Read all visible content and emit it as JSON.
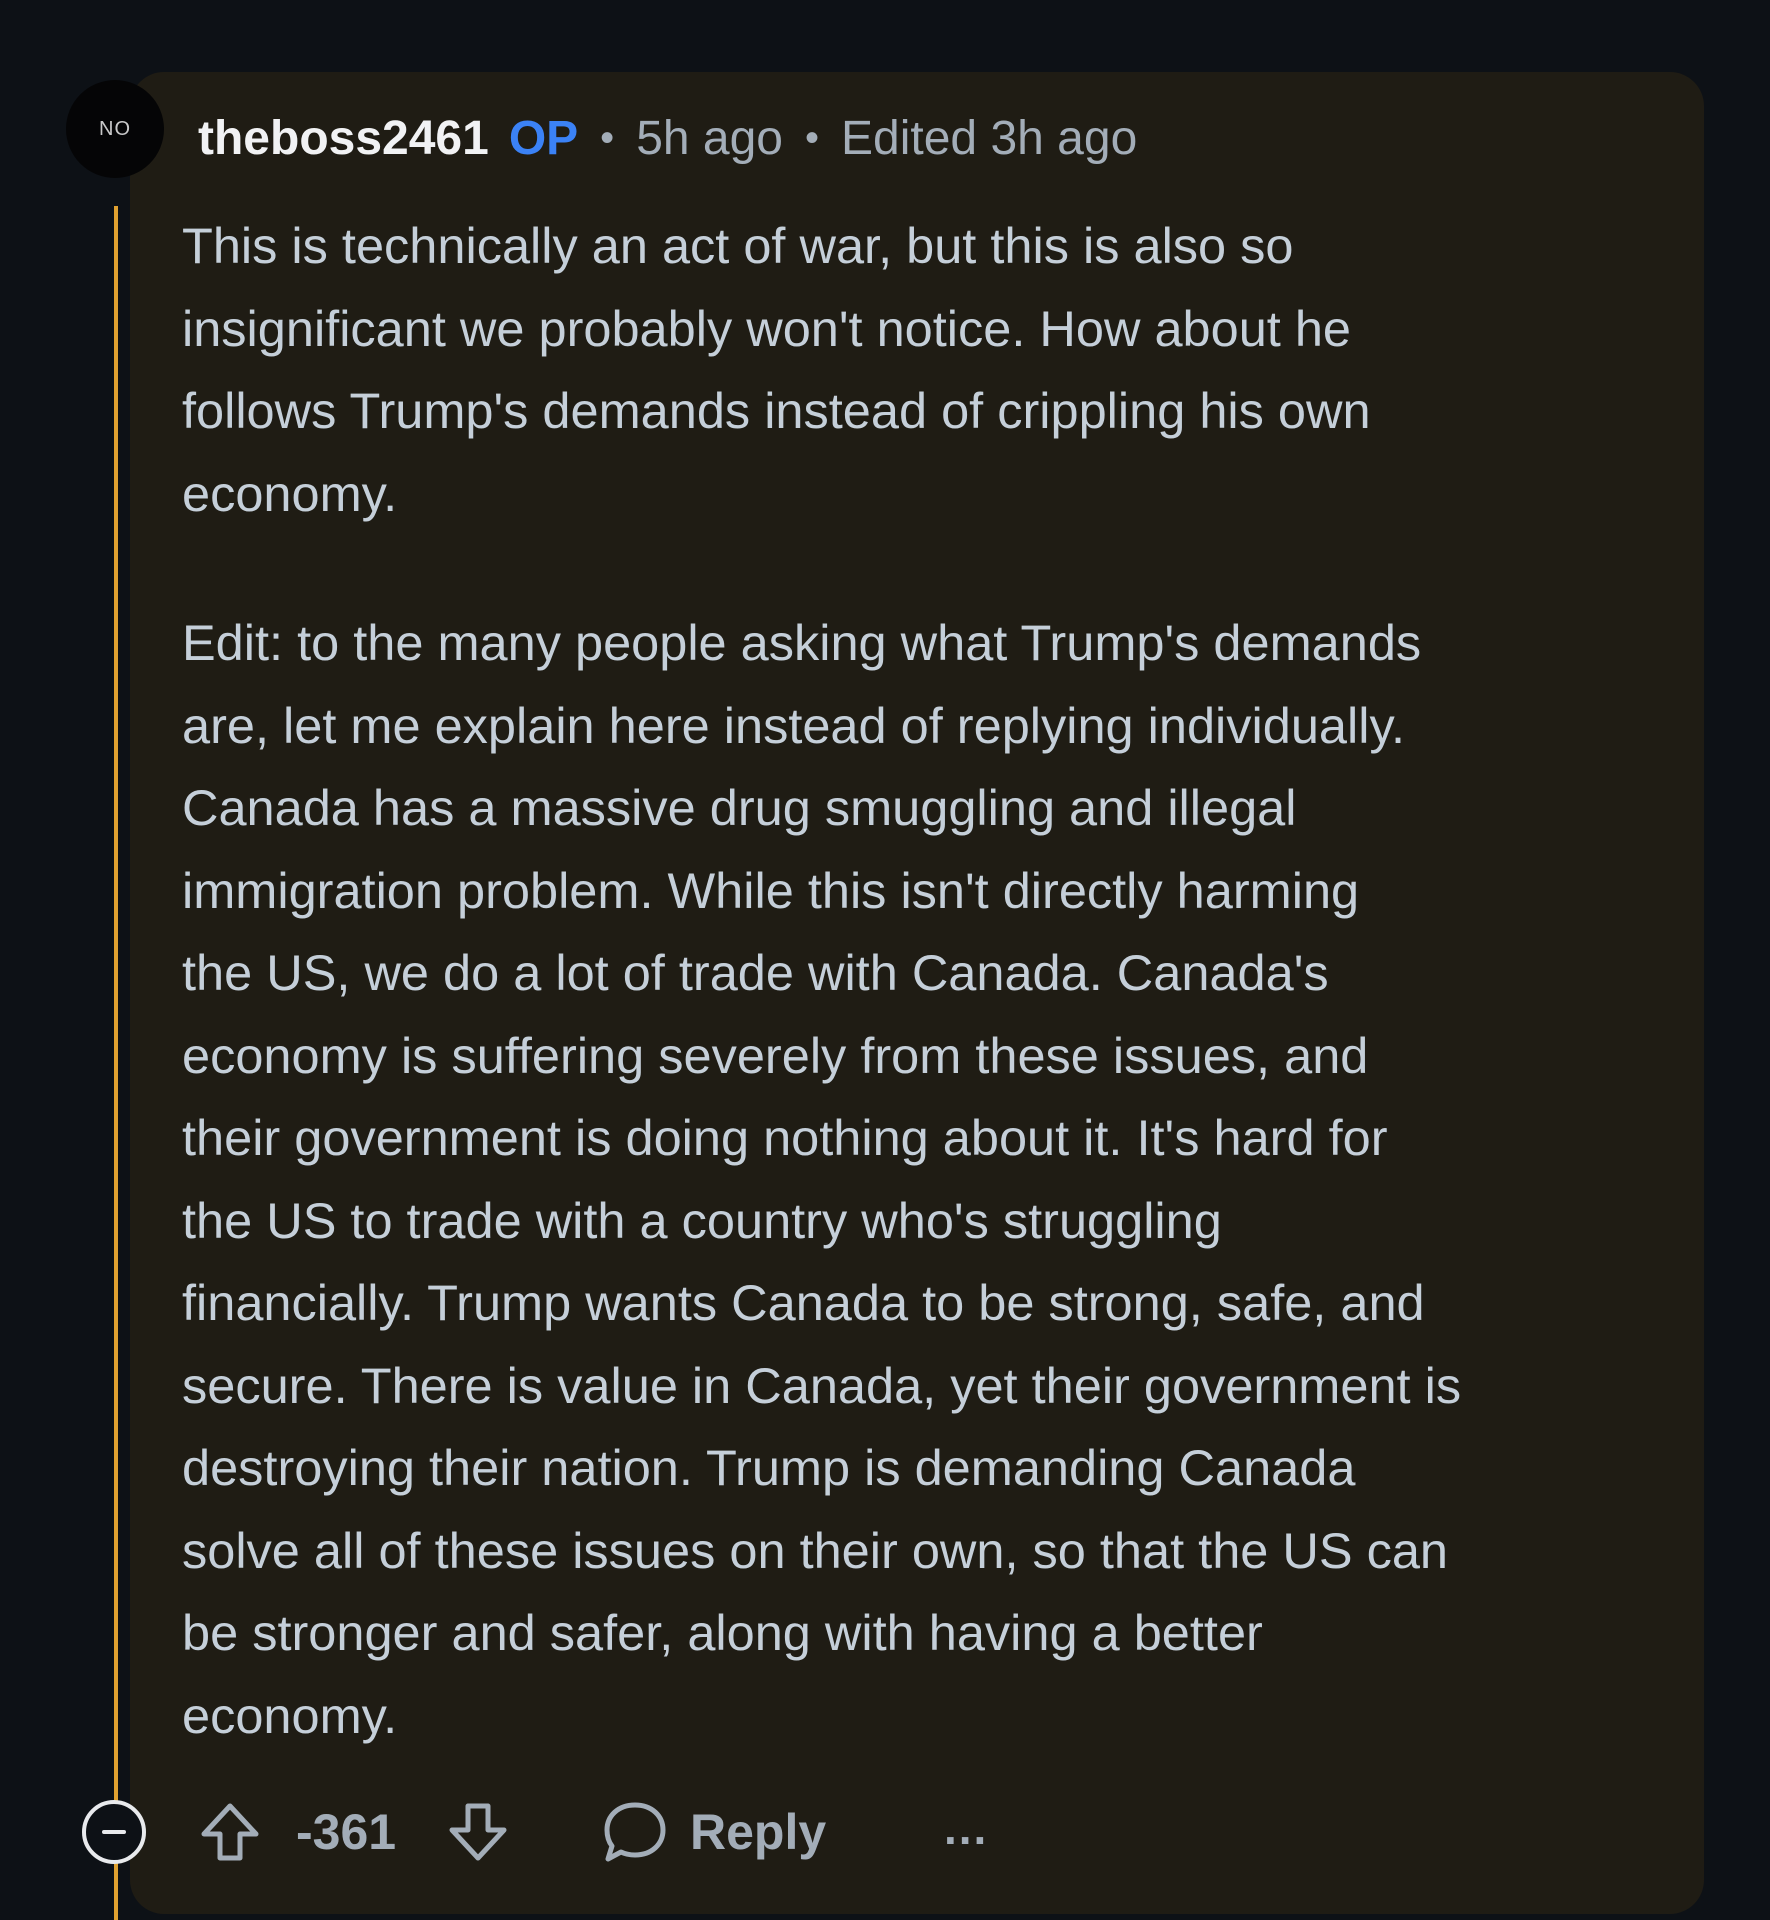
{
  "comment": {
    "avatar_text": "NO",
    "username": "theboss2461",
    "op_badge": "OP",
    "separator": "•",
    "time_posted": "5h ago",
    "edited": "Edited 3h ago",
    "paragraphs": [
      "This is technically an act of war, but this is also so\ninsignificant we probably won't notice. How about he\nfollows Trump's demands instead of crippling his own\neconomy.",
      "Edit: to the many people asking what Trump's demands\nare, let me explain here instead of replying individually.\nCanada has a massive drug smuggling and illegal\nimmigration problem. While this isn't directly harming\nthe US, we do a lot of trade with Canada. Canada's\neconomy is suffering severely from these issues, and\ntheir government is doing nothing about it. It's hard for\nthe US to trade with a country who's struggling\nfinancially. Trump wants Canada to be strong, safe, and\nsecure. There is value in Canada, yet their government is\ndestroying their nation. Trump is demanding Canada\nsolve all of these issues on their own, so that the US can\nbe stronger and safer, along with having a better\neconomy."
    ]
  },
  "actions": {
    "score": "-361",
    "reply_label": "Reply",
    "more_label": "..."
  },
  "icons": {
    "collapse": "minus-circle-icon",
    "upvote": "arrow-up-icon",
    "downvote": "arrow-down-icon",
    "reply": "speech-bubble-icon"
  },
  "colors": {
    "background": "#0d1116",
    "card": "#1f1c14",
    "thread_line": "#e0a130",
    "op_badge": "#3b82f6",
    "text": "#c5cfd9",
    "muted": "#a3adb8"
  }
}
